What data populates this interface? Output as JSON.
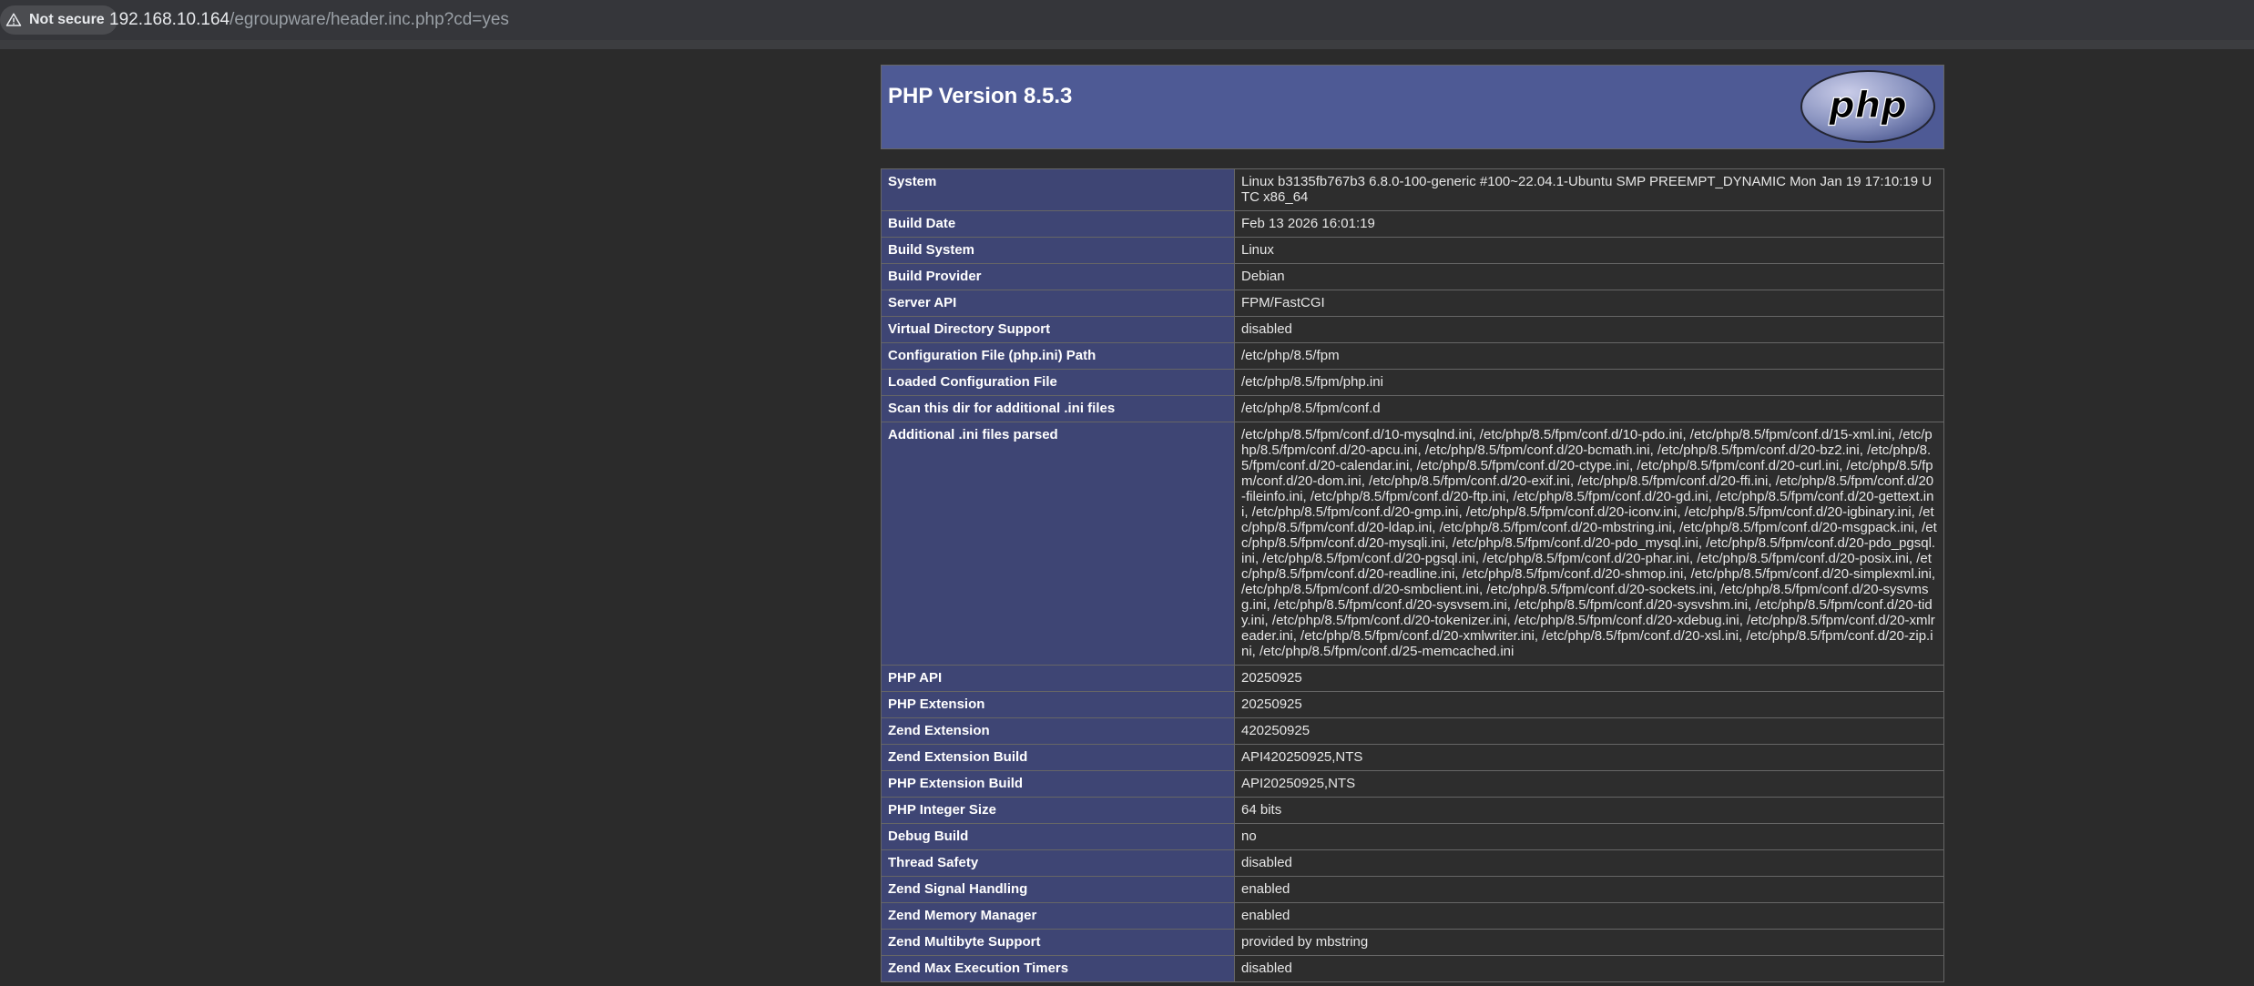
{
  "browser": {
    "security_label": "Not secure",
    "url_host": "192.168.10.164",
    "url_path": "/egroupware/header.inc.php?cd=yes"
  },
  "header": {
    "title": "PHP Version 8.5.3",
    "logo_text": "php"
  },
  "rows": [
    {
      "label": "System",
      "value": "Linux b3135fb767b3 6.8.0-100-generic #100~22.04.1-Ubuntu SMP PREEMPT_DYNAMIC Mon Jan 19 17:10:19 UTC x86_64"
    },
    {
      "label": "Build Date",
      "value": "Feb 13 2026 16:01:19"
    },
    {
      "label": "Build System",
      "value": "Linux"
    },
    {
      "label": "Build Provider",
      "value": "Debian"
    },
    {
      "label": "Server API",
      "value": "FPM/FastCGI"
    },
    {
      "label": "Virtual Directory Support",
      "value": "disabled"
    },
    {
      "label": "Configuration File (php.ini) Path",
      "value": "/etc/php/8.5/fpm"
    },
    {
      "label": "Loaded Configuration File",
      "value": "/etc/php/8.5/fpm/php.ini"
    },
    {
      "label": "Scan this dir for additional .ini files",
      "value": "/etc/php/8.5/fpm/conf.d"
    },
    {
      "label": "Additional .ini files parsed",
      "value": "/etc/php/8.5/fpm/conf.d/10-mysqlnd.ini, /etc/php/8.5/fpm/conf.d/10-pdo.ini, /etc/php/8.5/fpm/conf.d/15-xml.ini, /etc/php/8.5/fpm/conf.d/20-apcu.ini, /etc/php/8.5/fpm/conf.d/20-bcmath.ini, /etc/php/8.5/fpm/conf.d/20-bz2.ini, /etc/php/8.5/fpm/conf.d/20-calendar.ini, /etc/php/8.5/fpm/conf.d/20-ctype.ini, /etc/php/8.5/fpm/conf.d/20-curl.ini, /etc/php/8.5/fpm/conf.d/20-dom.ini, /etc/php/8.5/fpm/conf.d/20-exif.ini, /etc/php/8.5/fpm/conf.d/20-ffi.ini, /etc/php/8.5/fpm/conf.d/20-fileinfo.ini, /etc/php/8.5/fpm/conf.d/20-ftp.ini, /etc/php/8.5/fpm/conf.d/20-gd.ini, /etc/php/8.5/fpm/conf.d/20-gettext.ini, /etc/php/8.5/fpm/conf.d/20-gmp.ini, /etc/php/8.5/fpm/conf.d/20-iconv.ini, /etc/php/8.5/fpm/conf.d/20-igbinary.ini, /etc/php/8.5/fpm/conf.d/20-ldap.ini, /etc/php/8.5/fpm/conf.d/20-mbstring.ini, /etc/php/8.5/fpm/conf.d/20-msgpack.ini, /etc/php/8.5/fpm/conf.d/20-mysqli.ini, /etc/php/8.5/fpm/conf.d/20-pdo_mysql.ini, /etc/php/8.5/fpm/conf.d/20-pdo_pgsql.ini, /etc/php/8.5/fpm/conf.d/20-pgsql.ini, /etc/php/8.5/fpm/conf.d/20-phar.ini, /etc/php/8.5/fpm/conf.d/20-posix.ini, /etc/php/8.5/fpm/conf.d/20-readline.ini, /etc/php/8.5/fpm/conf.d/20-shmop.ini, /etc/php/8.5/fpm/conf.d/20-simplexml.ini, /etc/php/8.5/fpm/conf.d/20-smbclient.ini, /etc/php/8.5/fpm/conf.d/20-sockets.ini, /etc/php/8.5/fpm/conf.d/20-sysvmsg.ini, /etc/php/8.5/fpm/conf.d/20-sysvsem.ini, /etc/php/8.5/fpm/conf.d/20-sysvshm.ini, /etc/php/8.5/fpm/conf.d/20-tidy.ini, /etc/php/8.5/fpm/conf.d/20-tokenizer.ini, /etc/php/8.5/fpm/conf.d/20-xdebug.ini, /etc/php/8.5/fpm/conf.d/20-xmlreader.ini, /etc/php/8.5/fpm/conf.d/20-xmlwriter.ini, /etc/php/8.5/fpm/conf.d/20-xsl.ini, /etc/php/8.5/fpm/conf.d/20-zip.ini, /etc/php/8.5/fpm/conf.d/25-memcached.ini"
    },
    {
      "label": "PHP API",
      "value": "20250925"
    },
    {
      "label": "PHP Extension",
      "value": "20250925"
    },
    {
      "label": "Zend Extension",
      "value": "420250925"
    },
    {
      "label": "Zend Extension Build",
      "value": "API420250925,NTS"
    },
    {
      "label": "PHP Extension Build",
      "value": "API20250925,NTS"
    },
    {
      "label": "PHP Integer Size",
      "value": "64 bits"
    },
    {
      "label": "Debug Build",
      "value": "no"
    },
    {
      "label": "Thread Safety",
      "value": "disabled"
    },
    {
      "label": "Zend Signal Handling",
      "value": "enabled"
    },
    {
      "label": "Zend Memory Manager",
      "value": "enabled"
    },
    {
      "label": "Zend Multibyte Support",
      "value": "provided by mbstring"
    },
    {
      "label": "Zend Max Execution Timers",
      "value": "disabled"
    }
  ],
  "colors": {
    "header_bg": "#4e5a95",
    "label_bg": "#3e4574",
    "value_bg": "#2d2d2d",
    "page_bg": "#2b2b2b"
  }
}
